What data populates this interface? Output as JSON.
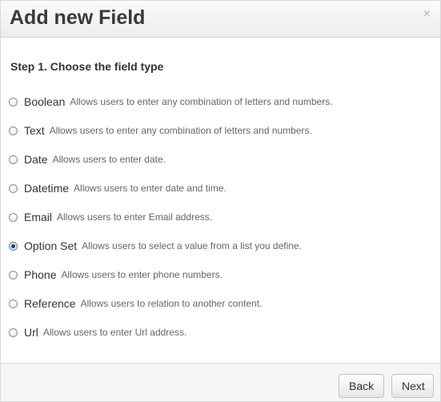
{
  "dialog": {
    "title": "Add new Field",
    "close_glyph": "×"
  },
  "step": {
    "title": "Step 1. Choose the field type"
  },
  "options": [
    {
      "label": "Boolean",
      "description": "Allows users to enter any combination of letters and numbers.",
      "selected": false
    },
    {
      "label": "Text",
      "description": "Allows users to enter any combination of letters and numbers.",
      "selected": false
    },
    {
      "label": "Date",
      "description": "Allows users to enter date.",
      "selected": false
    },
    {
      "label": "Datetime",
      "description": "Allows users to enter date and time.",
      "selected": false
    },
    {
      "label": "Email",
      "description": "Allows users to enter Email address.",
      "selected": false
    },
    {
      "label": "Option Set",
      "description": "Allows users to select a value from a list you define.",
      "selected": true
    },
    {
      "label": "Phone",
      "description": "Allows users to enter phone numbers.",
      "selected": false
    },
    {
      "label": "Reference",
      "description": "Allows users to relation to another content.",
      "selected": false
    },
    {
      "label": "Url",
      "description": "Allows users to enter Url address.",
      "selected": false
    }
  ],
  "footer": {
    "back_label": "Back",
    "next_label": "Next"
  },
  "colors": {
    "selected_radio_dot": "#1d3f78",
    "title_text": "#3a3a3a"
  }
}
